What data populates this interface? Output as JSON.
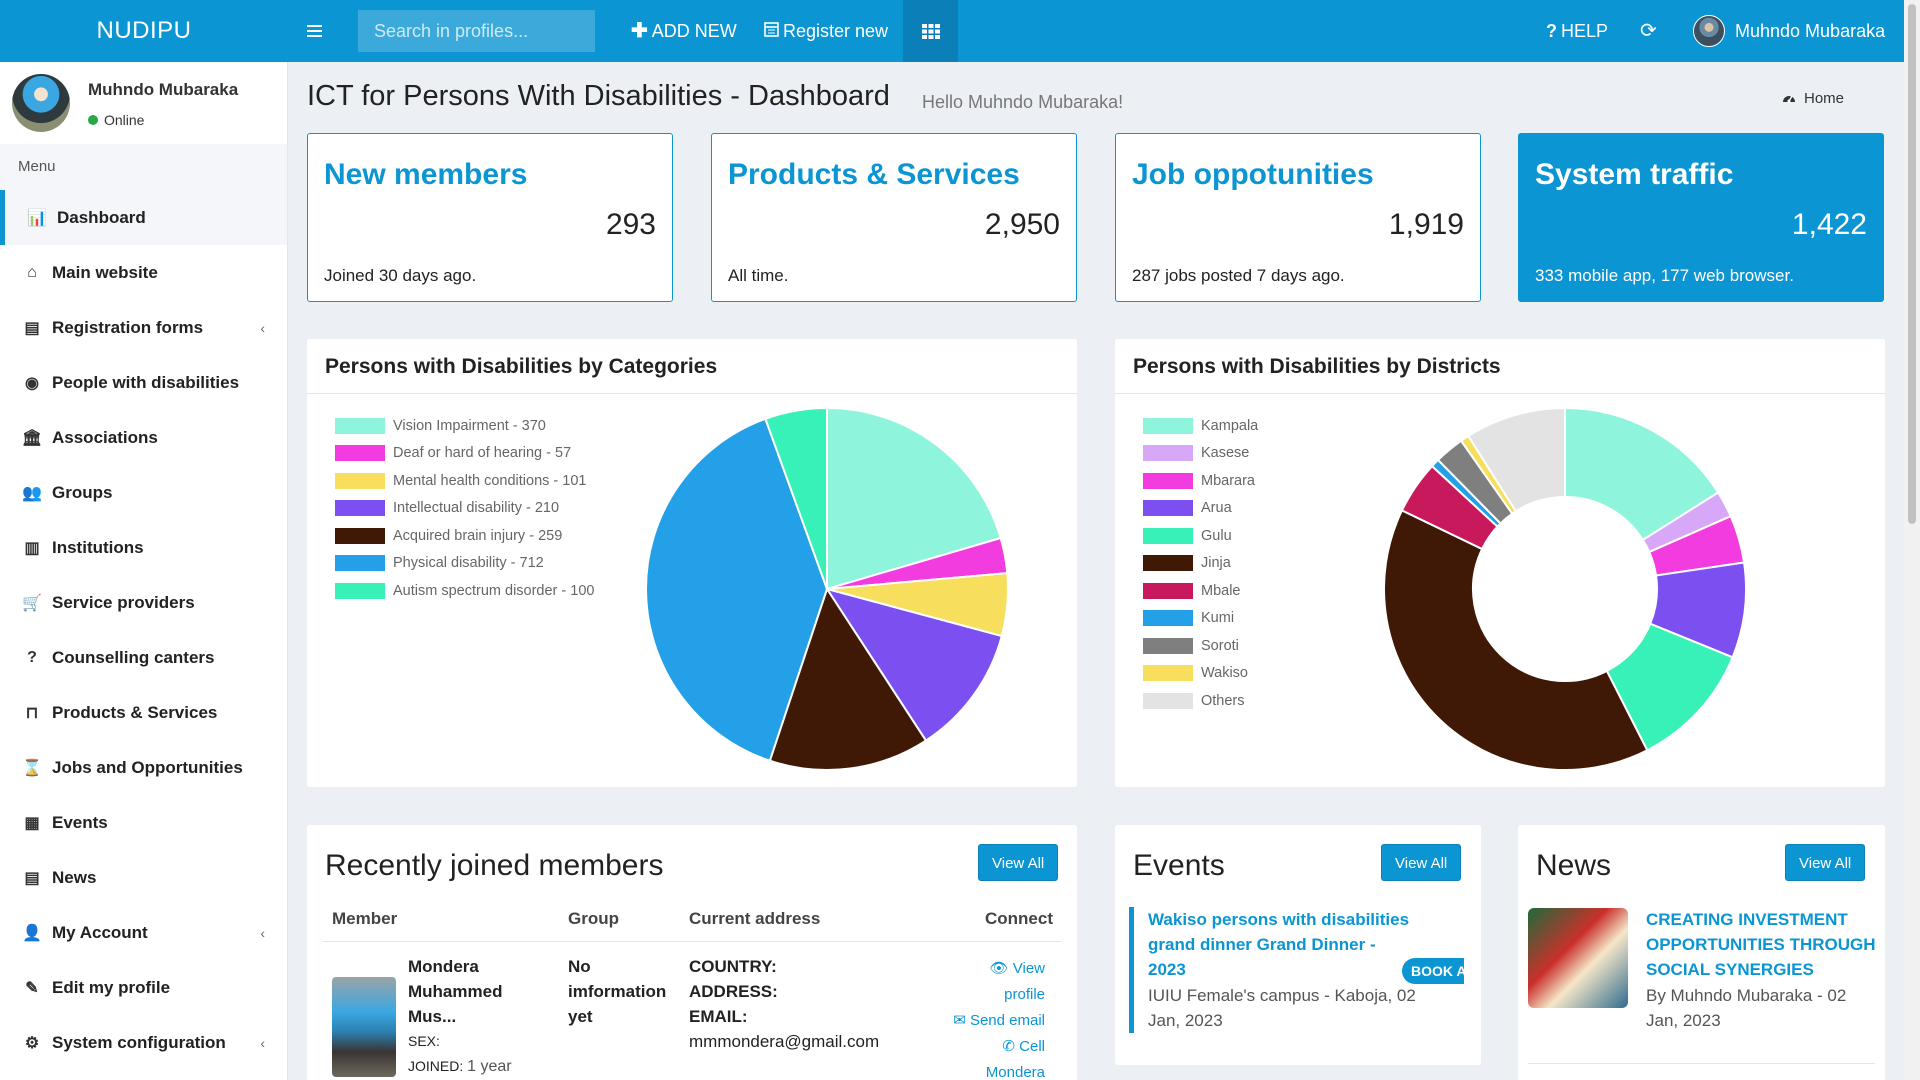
{
  "topbar": {
    "brand": "NUDIPU",
    "search_placeholder": "Search in profiles...",
    "add_new": "ADD NEW",
    "register_new": "Register new",
    "help": "HELP",
    "user_name": "Muhndo Mubaraka"
  },
  "sidebar": {
    "user_name": "Muhndo Mubaraka",
    "status": "Online",
    "menu_header": "Menu",
    "items": [
      {
        "label": "Dashboard",
        "icon": "bar-chart-icon"
      },
      {
        "label": "Main website",
        "icon": "home-icon"
      },
      {
        "label": "Registration forms",
        "icon": "form-icon"
      },
      {
        "label": "People with disabilities",
        "icon": "accessibility-icon"
      },
      {
        "label": "Associations",
        "icon": "institution-icon"
      },
      {
        "label": "Groups",
        "icon": "users-icon"
      },
      {
        "label": "Institutions",
        "icon": "building-icon"
      },
      {
        "label": "Service providers",
        "icon": "cart-icon"
      },
      {
        "label": "Counselling canters",
        "icon": "question-circle-icon"
      },
      {
        "label": "Products & Services",
        "icon": "inbox-icon"
      },
      {
        "label": "Jobs and Opportunities",
        "icon": "hourglass-icon"
      },
      {
        "label": "Events",
        "icon": "calendar-icon"
      },
      {
        "label": "News",
        "icon": "file-icon"
      },
      {
        "label": "My Account",
        "icon": "user-icon"
      },
      {
        "label": "Edit my profile",
        "icon": "edit-icon"
      },
      {
        "label": "System configuration",
        "icon": "cogs-icon"
      }
    ]
  },
  "page": {
    "title": "ICT for Persons With Disabilities - Dashboard",
    "subtitle": "Hello Muhndo Mubaraka!",
    "breadcrumb": "Home"
  },
  "stats": [
    {
      "title": "New members",
      "value": "293",
      "foot": "Joined 30 days ago."
    },
    {
      "title": "Products & Services",
      "value": "2,950",
      "foot": "All time."
    },
    {
      "title": "Job oppotunities",
      "value": "1,919",
      "foot": "287 jobs posted 7 days ago."
    },
    {
      "title": "System traffic",
      "value": "1,422",
      "foot": "333 mobile app, 177 web browser."
    }
  ],
  "chart_data": [
    {
      "type": "pie",
      "title": "Persons with Disabilities by Categories",
      "legend_position": "top-left",
      "categories": [
        "Vision Impairment - 370",
        "Deaf or hard of hearing - 57",
        "Mental health conditions - 101",
        "Intellectual disability - 210",
        "Acquired brain injury - 259",
        "Physical disability - 712",
        "Autism spectrum disorder - 100"
      ],
      "values": [
        370,
        57,
        101,
        210,
        259,
        712,
        100
      ],
      "colors": [
        "#8ef5dc",
        "#f23ce0",
        "#f7de5c",
        "#7c4ff0",
        "#3f1905",
        "#24a0e8",
        "#38f1b8"
      ]
    },
    {
      "type": "pie",
      "title": "Persons with Disabilities by Districts",
      "legend_position": "top-left",
      "categories": [
        "Kampala",
        "Kasese",
        "Mbarara",
        "Arua",
        "Gulu",
        "Jinja",
        "Mbale",
        "Kumi",
        "Soroti",
        "Wakiso",
        "Others"
      ],
      "values": [
        170,
        25,
        45,
        90,
        120,
        420,
        50,
        8,
        28,
        8,
        95
      ],
      "colors": [
        "#8ef5dc",
        "#d6a8f7",
        "#f23ce0",
        "#7c4ff0",
        "#38f1b8",
        "#3f1905",
        "#c9195d",
        "#24a0e8",
        "#7f7f7f",
        "#f7de5c",
        "#e3e3e3"
      ],
      "donut": true
    }
  ],
  "members": {
    "title": "Recently joined members",
    "view_all": "View All",
    "columns": [
      "Member",
      "Group",
      "Current address",
      "Connect"
    ],
    "rows": [
      {
        "name": "Mondera Muhammed Mus...",
        "sex_label": "SEX:",
        "joined_label": "JOINED:",
        "joined_value": "1 year",
        "group": "No imformation yet",
        "country_label": "COUNTRY:",
        "address_label": "ADDRESS:",
        "email_label": "EMAIL:",
        "email": "mmmondera@gmail.com",
        "view_profile": "View profile",
        "send_email": "Send email",
        "call": "Cell Mondera"
      }
    ]
  },
  "events": {
    "title": "Events",
    "view_all": "View All",
    "item_title": "Wakiso persons with disabilities grand dinner Grand Dinner - 2023",
    "item_place": "IUIU Female's campus - Kaboja, 02 Jan, 2023",
    "book": "BOOK A SEAT"
  },
  "news": {
    "title": "News",
    "view_all": "View All",
    "item_title": "CREATING INVESTMENT OPPORTUNITIES THROUGH SOCIAL SYNERGIES",
    "item_meta": "By Muhndo Mubaraka - 02 Jan, 2023"
  }
}
